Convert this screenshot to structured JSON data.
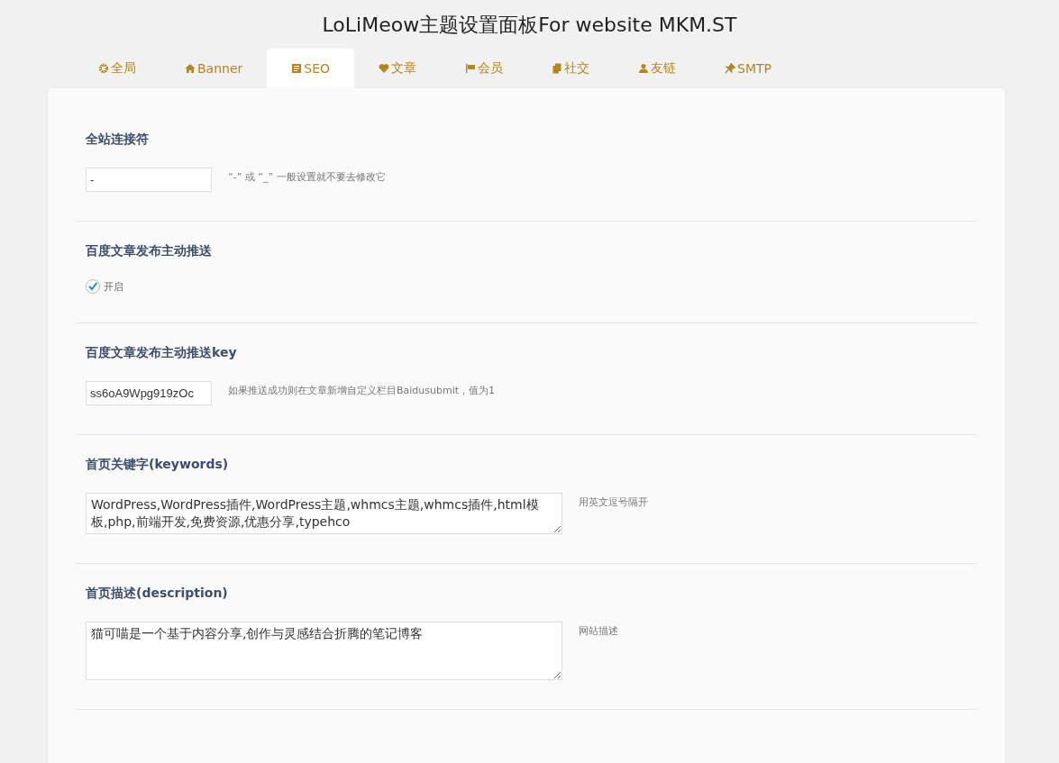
{
  "title": "LoLiMeow主题设置面板For website MKM.ST",
  "tabs": [
    {
      "label": "全局",
      "selected": false
    },
    {
      "label": "Banner",
      "selected": false
    },
    {
      "label": "SEO",
      "selected": true
    },
    {
      "label": "文章",
      "selected": false
    },
    {
      "label": "会员",
      "selected": false
    },
    {
      "label": "社交",
      "selected": false
    },
    {
      "label": "友链",
      "selected": false
    },
    {
      "label": "SMTP",
      "selected": false
    }
  ],
  "sections": [
    {
      "kind": "input",
      "heading": "全站连接符",
      "value": "-",
      "hint": "“-” 或 “_” 一般设置就不要去修改它"
    },
    {
      "kind": "checkbox",
      "heading": "百度文章发布主动推送",
      "label": "开启",
      "checked": true
    },
    {
      "kind": "input",
      "heading": "百度文章发布主动推送key",
      "value": "ss6oA9Wpg919zOc",
      "hint": "如果推送成功则在文章新增自定义栏目Baidusubmit，值为1"
    },
    {
      "kind": "textarea",
      "heading": "首页关键字(keywords)",
      "value": "WordPress,WordPress插件,WordPress主题,whmcs主题,whmcs插件,html模板,php,前端开发,免费资源,优惠分享,typehco",
      "hint": "用英文逗号隔开"
    },
    {
      "kind": "textarea",
      "heading": "首页描述(description)",
      "value": "猫可喵是一个基于内容分享,创作与灵感结合折腾的笔记博客",
      "hint": "网站描述"
    }
  ]
}
